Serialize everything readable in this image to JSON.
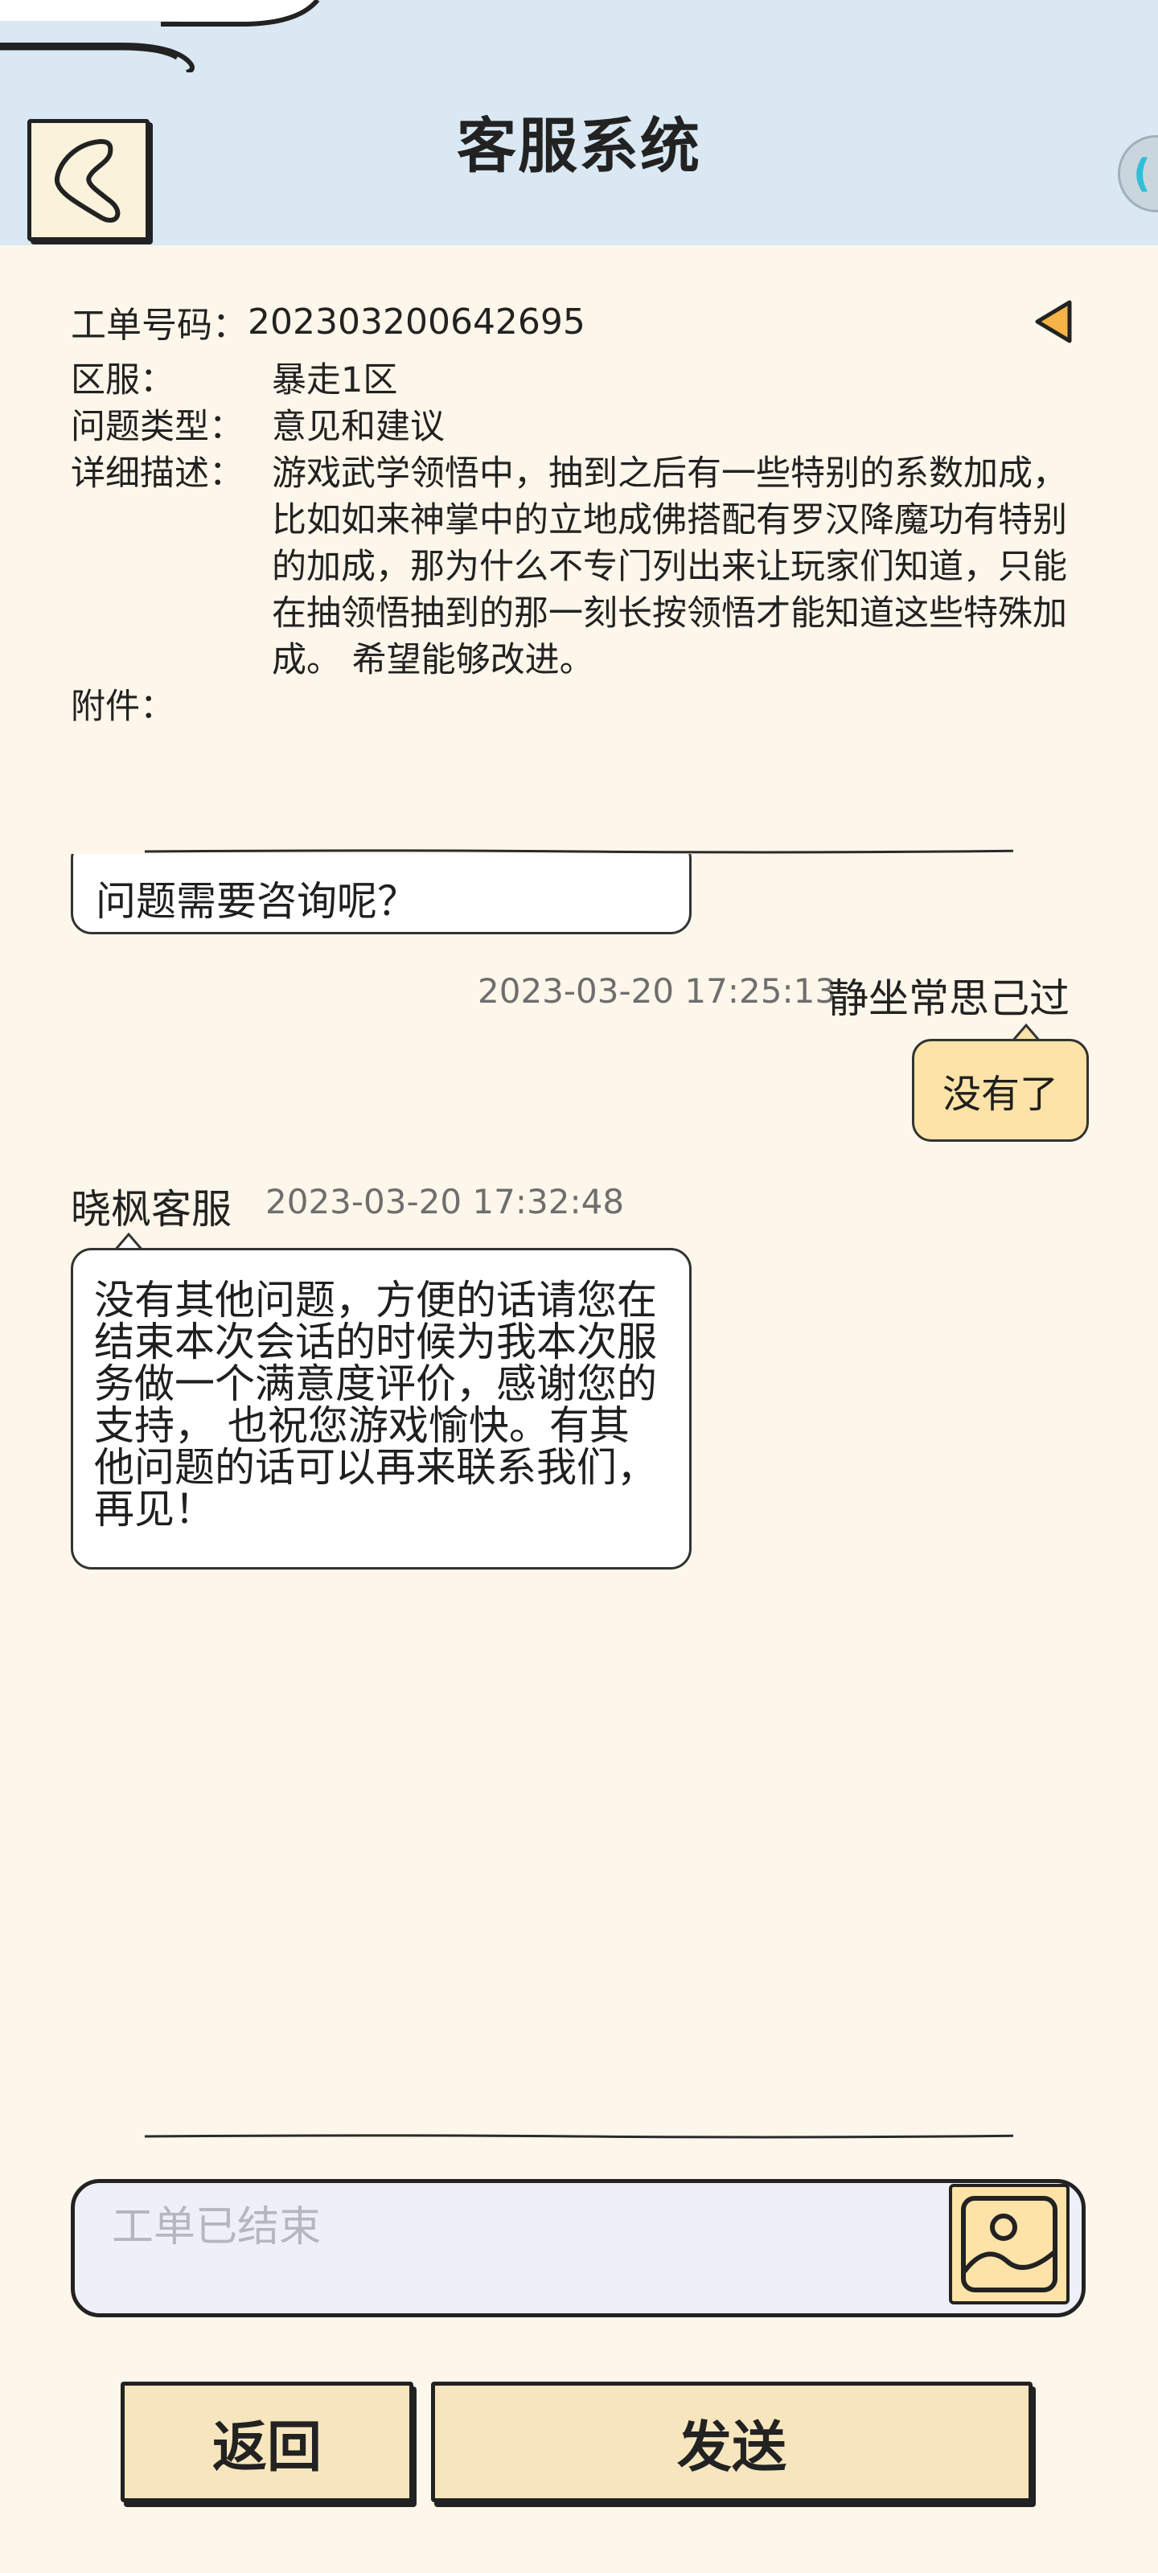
{
  "header": {
    "title": "客服系统"
  },
  "ticket": {
    "number_label": "工单号码：",
    "number_value": "202303200642695",
    "rows": [
      {
        "label": "区服：",
        "value": "暴走1区"
      },
      {
        "label": "问题类型：",
        "value": "意见和建议"
      },
      {
        "label": "详细描述：",
        "value": "游戏武学领悟中，抽到之后有一些特别的系数加成，比如如来神掌中的立地成佛搭配有罗汉降魔功有特别的加成，那为什么不专门列出来让玩家们知道，只能在抽领悟抽到的那一刻长按领悟才能知道这些特殊加成。 希望能够改进。"
      },
      {
        "label": "附件：",
        "value": ""
      }
    ]
  },
  "chat": {
    "partial_message": "问题需要咨询呢？",
    "user_message": {
      "timestamp": "2023-03-20 17:25:13",
      "sender": "静坐常思己过",
      "text": "没有了"
    },
    "agent_message": {
      "sender": "晓枫客服",
      "timestamp": "2023-03-20 17:32:48",
      "text": "没有其他问题，方便的话请您在结束本次会话的时候为我本次服务做一个满意度评价，感谢您的支持， 也祝您游戏愉快。有其他问题的话可以再来联系我们，再见！"
    }
  },
  "input": {
    "placeholder": "工单已结束"
  },
  "buttons": {
    "back_label": "返回",
    "send_label": "发送"
  },
  "colors": {
    "page_bg": "#fdf6ea",
    "header_bg": "#d9e8f2",
    "user_bubble": "#fde3a8",
    "button_bg": "#f7e6bd",
    "collapse_arrow": "#f6b347"
  },
  "icons": {
    "back": "chevron-left-icon",
    "collapse": "triangle-left-icon",
    "image": "image-icon"
  }
}
